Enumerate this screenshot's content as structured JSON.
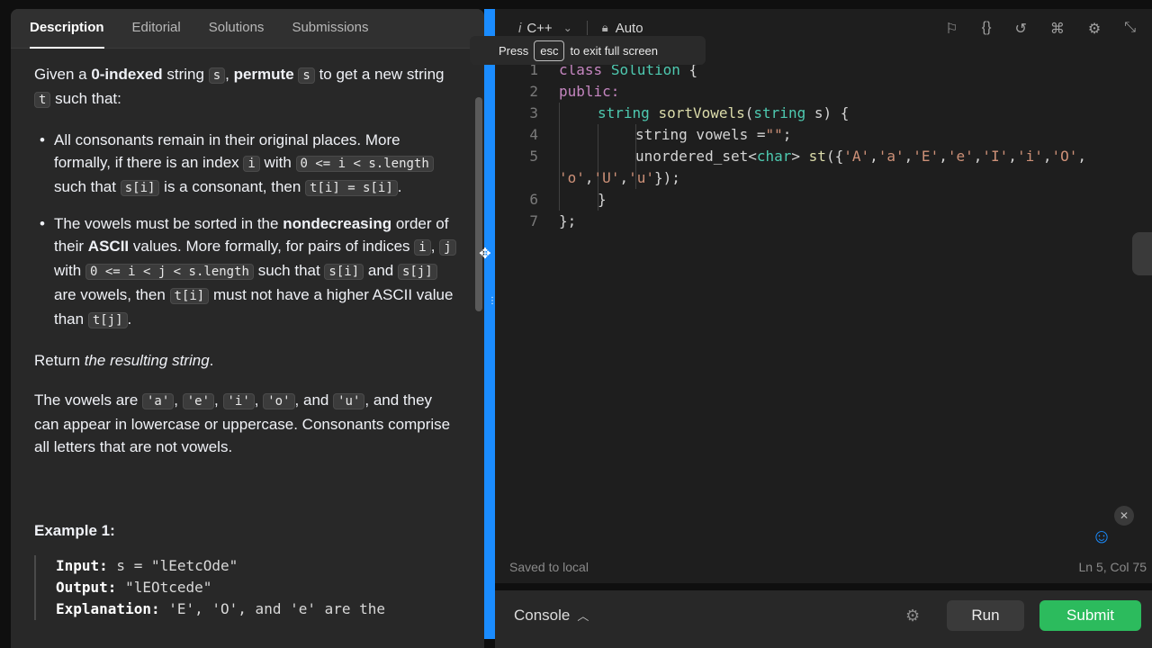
{
  "tabs": [
    "Description",
    "Editorial",
    "Solutions",
    "Submissions"
  ],
  "description": {
    "p1": {
      "a": "Given a ",
      "b": "0-indexed",
      "c": " string ",
      "d": "s",
      "e": ", ",
      "f": "permute",
      "g": " ",
      "h": "s",
      "i": " to get a new string ",
      "j": "t",
      "k": " such that:"
    },
    "bullet1": {
      "a": "All consonants remain in their original places. More formally, if there is an index ",
      "b": "i",
      "c": " with ",
      "d": "0 <= i < s.length",
      "e": " such that ",
      "f": "s[i]",
      "g": " is a consonant, then ",
      "h": "t[i] = s[i]",
      "i": "."
    },
    "bullet2": {
      "a": "The vowels must be sorted in the ",
      "b": "nondecreasing",
      "c": " order of their ",
      "d": "ASCII",
      "e": " values. More formally, for pairs of indices ",
      "f": "i",
      "g": ", ",
      "h": "j",
      "i": " with ",
      "j": "0 <= i < j < s.length",
      "k": " such that ",
      "l": "s[i]",
      "m": " and ",
      "n": "s[j]",
      "o": " are vowels, then ",
      "p": "t[i]",
      "q": " must not have a higher ASCII value than ",
      "r": "t[j]",
      "s": "."
    },
    "p2": {
      "a": "Return ",
      "b": "the resulting string",
      "c": "."
    },
    "p3": {
      "a": "The vowels are ",
      "v1": "'a'",
      "s1": ", ",
      "v2": "'e'",
      "s2": ", ",
      "v3": "'i'",
      "s3": ", ",
      "v4": "'o'",
      "s4": ", and ",
      "v5": "'u'",
      "b": ", and they can appear in lowercase or uppercase. Consonants comprise all letters that are not vowels."
    },
    "example_title": "Example 1:",
    "example": {
      "input_label": "Input:",
      "input_val": " s = \"lEetcOde\"",
      "output_label": "Output:",
      "output_val": " \"lEOtcede\"",
      "explanation_label": "Explanation:",
      "explanation_val": " 'E', 'O', and 'e' are the"
    }
  },
  "divider_dots": "⋮",
  "editor": {
    "lang_i": "i",
    "language": "C++",
    "mode": "Auto",
    "tooltip": {
      "press": "Press",
      "key": "esc",
      "rest": "to exit full screen"
    },
    "code": {
      "l1": {
        "num": "1",
        "a": "class",
        "b": " ",
        "c": "Solution",
        "d": " {"
      },
      "l2": {
        "num": "2",
        "a": "public:"
      },
      "l3": {
        "num": "3",
        "a": "string",
        "b": " ",
        "c": "sortVowels",
        "d": "(",
        "e": "string",
        "f": " s) {"
      },
      "l4": {
        "num": "4",
        "a": "string",
        "b": " vowels =",
        "c": "\"\"",
        "d": ";"
      },
      "l5": {
        "num": "5",
        "a": "unordered_set",
        "b": "<",
        "c": "char",
        "d": "> ",
        "e": "st",
        "f": "({",
        "g": "'A'",
        "h": ",",
        "i": "'a'",
        "j": ",",
        "k": "'E'",
        "l": ",",
        "m": "'e'",
        "n": ",",
        "o": "'I'",
        "p": ",",
        "q": "'i'",
        "r": ",",
        "s": "'O'",
        "t": ",",
        "wrap1": "'o'",
        "wrap2": ",",
        "wrap3": "'U'",
        "wrap4": ",",
        "wrap5": "'u'",
        "wrap6": "});"
      },
      "l6": {
        "num": "6",
        "a": "}"
      },
      "l7": {
        "num": "7",
        "a": "};"
      }
    },
    "status_saved": "Saved to local",
    "status_pos": "Ln 5, Col 75"
  },
  "console": {
    "label": "Console",
    "run": "Run",
    "submit": "Submit"
  },
  "colors": {
    "accent": "#1a8cff",
    "submit": "#2cbb5d"
  },
  "icons": [
    "bookmark-icon",
    "braces-icon",
    "reset-icon",
    "command-icon",
    "settings-icon",
    "collapse-icon",
    "lock-icon",
    "chevron-down-icon",
    "chevron-up-icon",
    "debug-icon",
    "chat-icon",
    "close-icon",
    "move-icon"
  ]
}
